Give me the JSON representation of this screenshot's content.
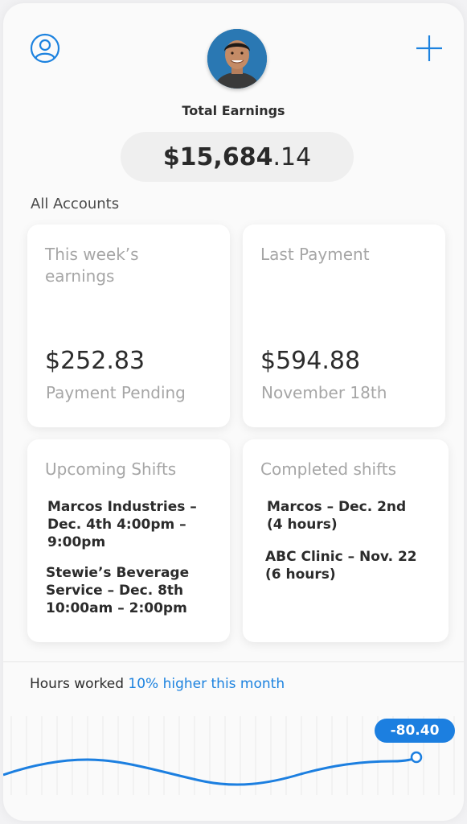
{
  "header": {
    "total_label": "Total Earnings",
    "total_main": "$15,684",
    "total_cents": ".14",
    "accounts_label": "All Accounts"
  },
  "icons": {
    "profile": "user-circle-icon",
    "add": "plus-icon",
    "avatar": "profile-photo"
  },
  "cards": {
    "weekly": {
      "title": "This week’s earnings",
      "amount": "$252.83",
      "sub": "Payment Pending"
    },
    "last_payment": {
      "title": "Last Payment",
      "amount": "$594.88",
      "sub": "November 18th"
    },
    "upcoming": {
      "title": "Upcoming Shifts",
      "items": [
        "Marcos Industries – Dec. 4th 4:00pm – 9:00pm",
        "Stewie’s Beverage Service – Dec. 8th 10:00am – 2:00pm"
      ]
    },
    "completed": {
      "title": "Completed shifts",
      "items": [
        "Marcos – Dec. 2nd (4 hours)",
        "ABC Clinic – Nov. 22 (6 hours)"
      ]
    }
  },
  "hours": {
    "label": "Hours worked",
    "accent": "10% higher this month",
    "value_badge": "-80.40"
  },
  "colors": {
    "accent": "#1c82df",
    "background": "#fafafa"
  }
}
